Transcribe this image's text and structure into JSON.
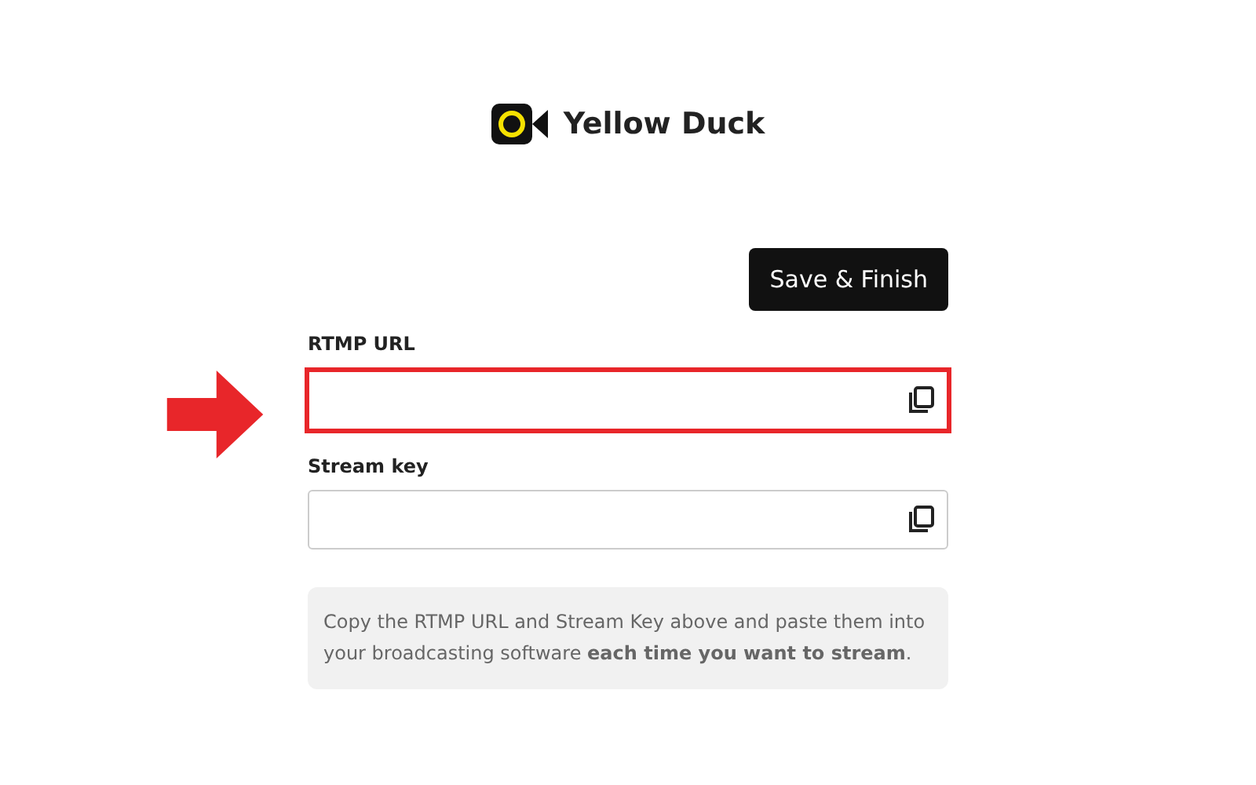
{
  "brand": {
    "name": "Yellow Duck"
  },
  "save_button": {
    "label": "Save & Finish"
  },
  "fields": [
    {
      "label": "RTMP URL",
      "highlighted": true
    },
    {
      "label": "Stream key",
      "highlighted": false
    }
  ],
  "info": {
    "text": "Copy the RTMP URL and Stream Key above and paste them into your broadcasting software **each time you want to stream**."
  }
}
